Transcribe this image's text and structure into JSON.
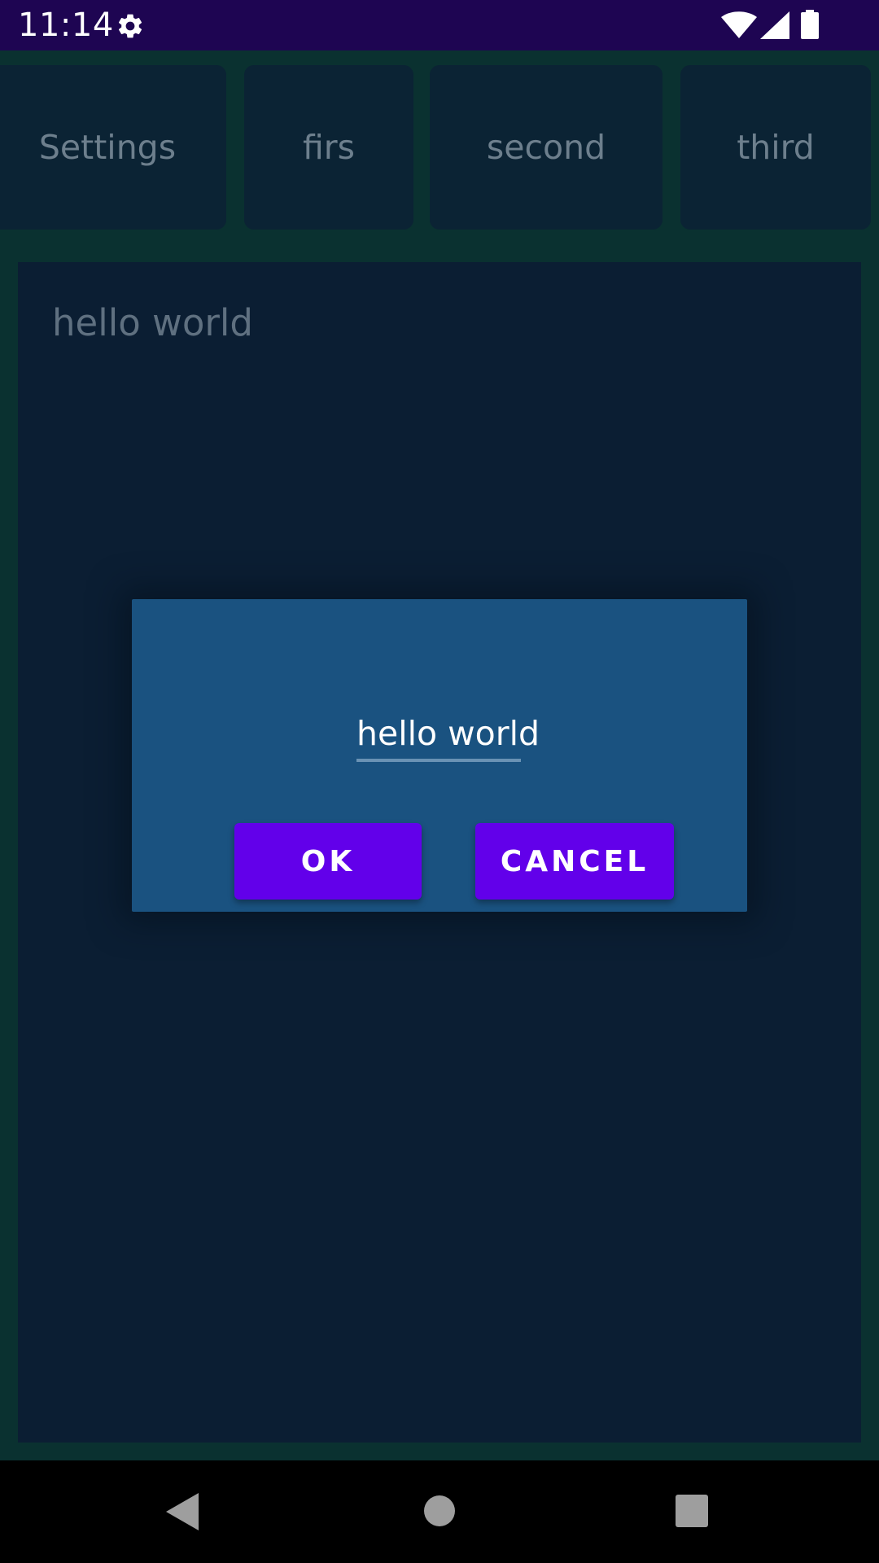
{
  "status_bar": {
    "time": "11:14",
    "icons": [
      "gear-icon",
      "wifi-icon",
      "cell-signal-icon",
      "battery-icon"
    ]
  },
  "tabs": [
    {
      "label": "Settings"
    },
    {
      "label": "firs"
    },
    {
      "label": "second"
    },
    {
      "label": "third"
    }
  ],
  "content": {
    "text": "hello world"
  },
  "dialog": {
    "input_value": "hello world",
    "ok_label": "OK",
    "cancel_label": "CANCEL"
  },
  "nav_bar": {
    "icons": [
      "back-icon",
      "home-icon",
      "recents-icon"
    ]
  },
  "colors": {
    "accent": "#6200ea",
    "status_bar": "#1e0552",
    "dialog_bg": "#1a5280",
    "card_bg": "#0b1e33",
    "screen_bg": "#0a3130"
  }
}
